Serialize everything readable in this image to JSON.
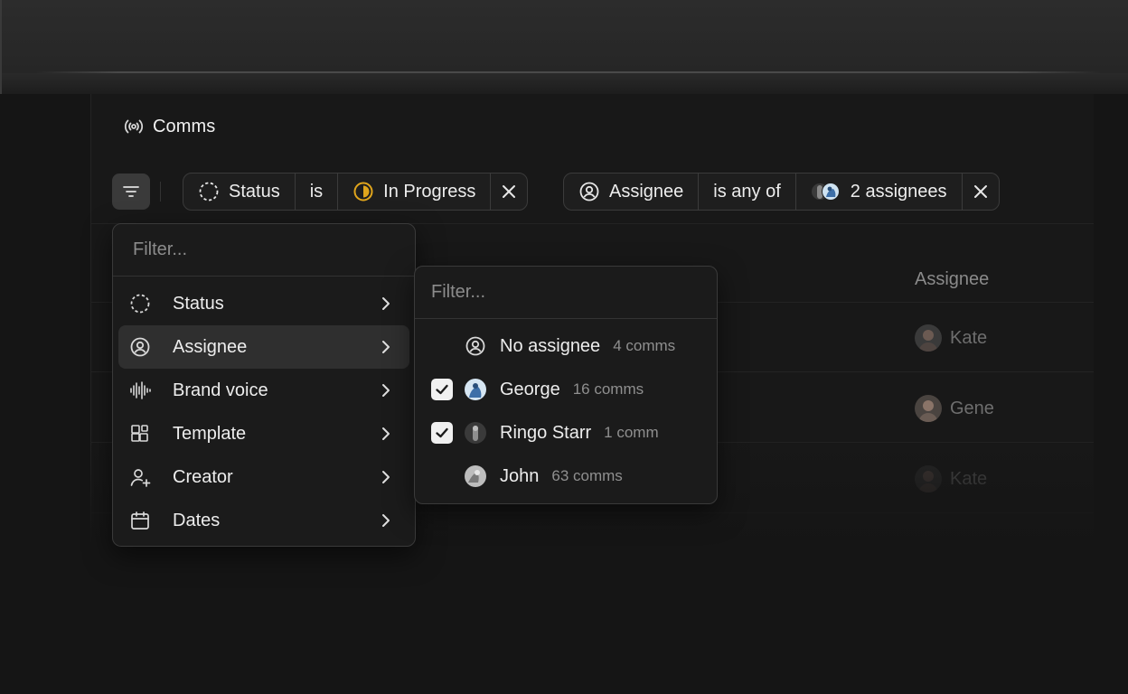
{
  "page": {
    "title": "Comms",
    "title_icon": "broadcast-icon"
  },
  "filter_bar": {
    "filter_button_icon": "filter-lines-icon",
    "chips": [
      {
        "field": "Status",
        "field_icon": "dashed-circle-icon",
        "operator": "is",
        "value": "In Progress",
        "value_icon": "half-filled-circle-icon",
        "remove_icon": "close-icon"
      },
      {
        "field": "Assignee",
        "field_icon": "user-circle-icon",
        "operator": "is any of",
        "value": "2 assignees",
        "value_icon": "stacked-avatars-icon",
        "remove_icon": "close-icon"
      }
    ]
  },
  "table": {
    "column_header": "Assignee",
    "rows": [
      {
        "assignee": "Kate"
      },
      {
        "assignee": "Gene"
      },
      {
        "assignee": "Kate"
      }
    ]
  },
  "filter_menu": {
    "placeholder": "Filter...",
    "items": [
      {
        "label": "Status",
        "icon": "dashed-circle-icon"
      },
      {
        "label": "Assignee",
        "icon": "user-circle-icon",
        "active": true
      },
      {
        "label": "Brand voice",
        "icon": "waveform-icon"
      },
      {
        "label": "Template",
        "icon": "template-blocks-icon"
      },
      {
        "label": "Creator",
        "icon": "user-plus-icon"
      },
      {
        "label": "Dates",
        "icon": "calendar-icon"
      }
    ]
  },
  "assignee_menu": {
    "placeholder": "Filter...",
    "options": [
      {
        "label": "No assignee",
        "count": "4 comms",
        "checked": false
      },
      {
        "label": "George",
        "count": "16 comms",
        "checked": true
      },
      {
        "label": "Ringo Starr",
        "count": "1 comm",
        "checked": true
      },
      {
        "label": "John",
        "count": "63 comms",
        "checked": false
      }
    ]
  },
  "colors": {
    "in_progress": "#e0a51c",
    "accent_blue": "#6fa8dc"
  }
}
